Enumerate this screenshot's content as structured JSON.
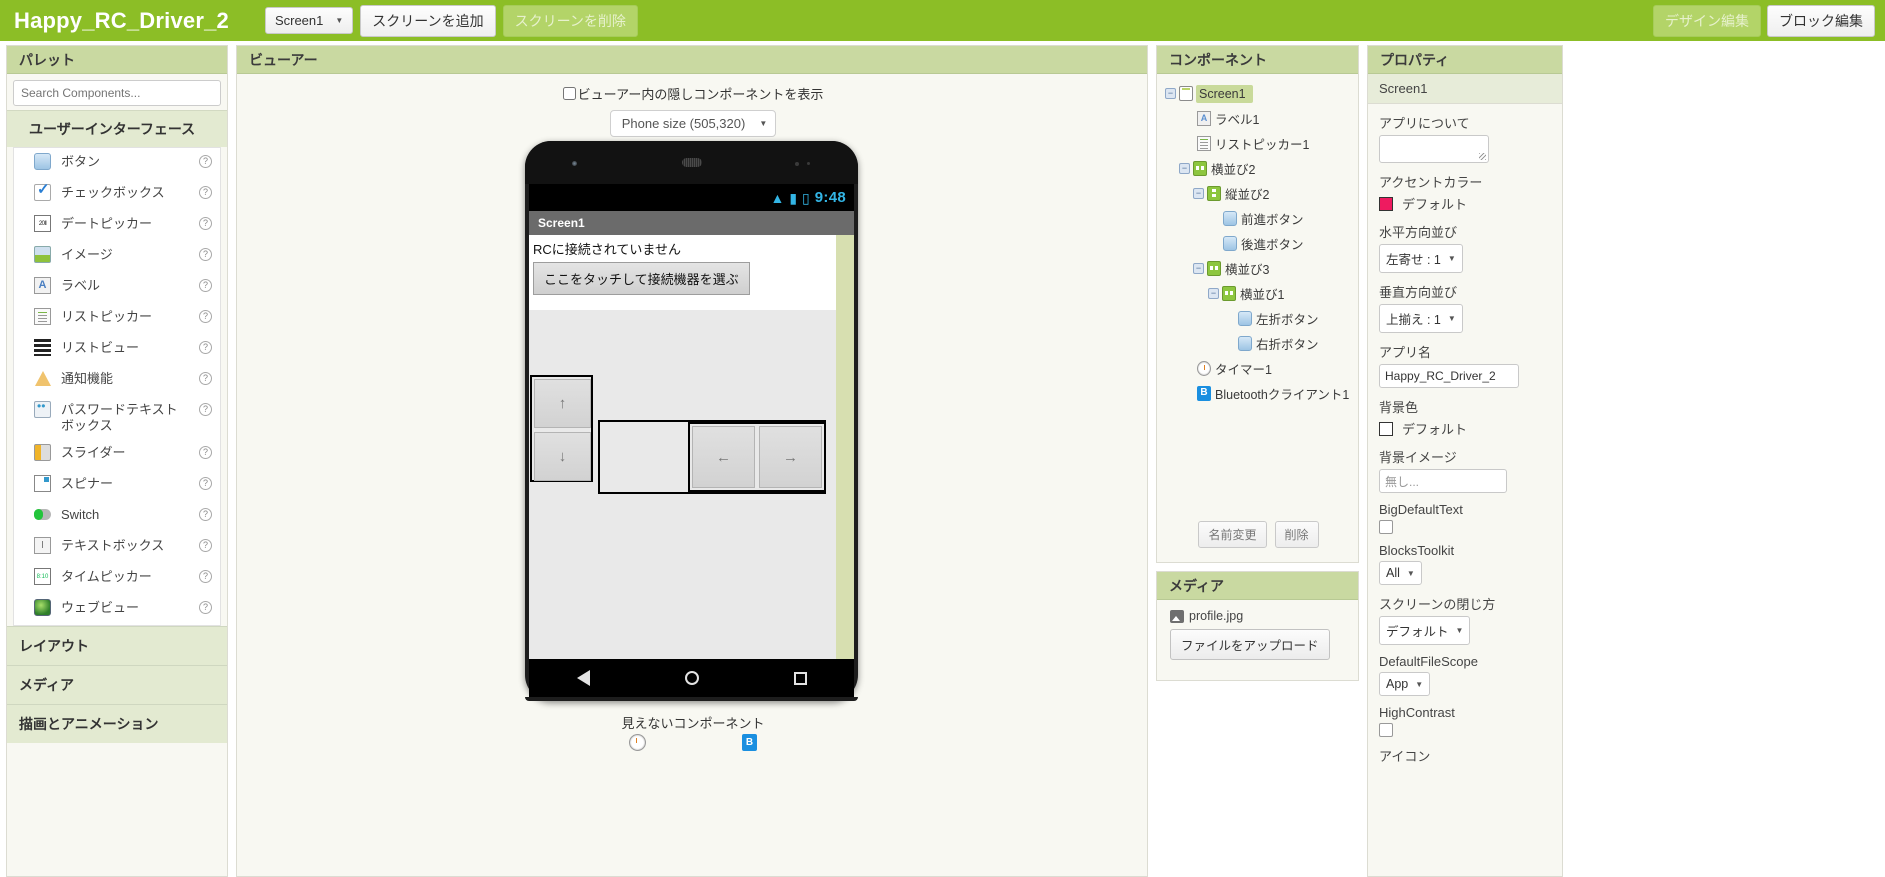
{
  "topbar": {
    "project_title": "Happy_RC_Driver_2",
    "screen_select": "Screen1",
    "add_screen": "スクリーンを追加",
    "remove_screen": "スクリーンを削除",
    "designer_tab": "デザイン編集",
    "blocks_tab": "ブロック編集",
    "brand_color": "#8cbe26"
  },
  "palette": {
    "title": "パレット",
    "search_placeholder": "Search Components...",
    "category": "ユーザーインターフェース",
    "items": [
      {
        "label": "ボタン",
        "icon": "button-icon",
        "help": "?"
      },
      {
        "label": "チェックボックス",
        "icon": "checkbox-icon",
        "help": "?"
      },
      {
        "label": "デートピッカー",
        "icon": "datepicker-icon",
        "help": "?"
      },
      {
        "label": "イメージ",
        "icon": "image-icon",
        "help": "?"
      },
      {
        "label": "ラベル",
        "icon": "label-icon",
        "help": "?"
      },
      {
        "label": "リストピッカー",
        "icon": "listpicker-icon",
        "help": "?"
      },
      {
        "label": "リストビュー",
        "icon": "listview-icon",
        "help": "?"
      },
      {
        "label": "通知機能",
        "icon": "notifier-icon",
        "help": "?"
      },
      {
        "label": "パスワードテキストボックス",
        "icon": "password-textbox-icon",
        "help": "?"
      },
      {
        "label": "スライダー",
        "icon": "slider-icon",
        "help": "?"
      },
      {
        "label": "スピナー",
        "icon": "spinner-icon",
        "help": "?"
      },
      {
        "label": "Switch",
        "icon": "switch-icon",
        "help": "?"
      },
      {
        "label": "テキストボックス",
        "icon": "textbox-icon",
        "help": "?"
      },
      {
        "label": "タイムピッカー",
        "icon": "timepicker-icon",
        "help": "?"
      },
      {
        "label": "ウェブビュー",
        "icon": "webview-icon",
        "help": "?"
      }
    ],
    "collapsed_categories": [
      "レイアウト",
      "メディア",
      "描画とアニメーション"
    ]
  },
  "viewer": {
    "title": "ビューアー",
    "show_hidden_label": "ビューアー内の隠しコンポーネントを表示",
    "show_hidden_checked": false,
    "phone_size": "Phone size (505,320)",
    "invisible_label": "見えないコンポーネント",
    "phone": {
      "status_time": "9:48",
      "title": "Screen1",
      "status_text": "RCに接続されていません",
      "listpicker_label": "ここをタッチして接続機器を選ぶ",
      "btn_forward": "↑",
      "btn_backward": "↓",
      "btn_left": "←",
      "btn_right": "→"
    }
  },
  "components": {
    "title": "コンポーネント",
    "tree": [
      {
        "label": "Screen1",
        "icon": "screen-icon",
        "depth": 0,
        "toggle": "−",
        "selected": true
      },
      {
        "label": "ラベル1",
        "icon": "label-icon",
        "depth": 1,
        "toggle": "",
        "selected": false
      },
      {
        "label": "リストピッカー1",
        "icon": "listpicker-icon",
        "depth": 1,
        "toggle": "",
        "selected": false
      },
      {
        "label": "横並び2",
        "icon": "horizontal-arrangement-icon",
        "depth": 1,
        "toggle": "−",
        "selected": false
      },
      {
        "label": "縦並び2",
        "icon": "vertical-arrangement-icon",
        "depth": 2,
        "toggle": "−",
        "selected": false
      },
      {
        "label": "前進ボタン",
        "icon": "button-icon",
        "depth": 3,
        "toggle": "",
        "selected": false
      },
      {
        "label": "後進ボタン",
        "icon": "button-icon",
        "depth": 3,
        "toggle": "",
        "selected": false
      },
      {
        "label": "横並び3",
        "icon": "horizontal-arrangement-icon",
        "depth": 2,
        "toggle": "−",
        "selected": false
      },
      {
        "label": "横並び1",
        "icon": "horizontal-arrangement-icon",
        "depth": 3,
        "toggle": "−",
        "selected": false
      },
      {
        "label": "左折ボタン",
        "icon": "button-icon",
        "depth": 4,
        "toggle": "",
        "selected": false
      },
      {
        "label": "右折ボタン",
        "icon": "button-icon",
        "depth": 4,
        "toggle": "",
        "selected": false
      },
      {
        "label": "タイマー1",
        "icon": "clock-icon",
        "depth": 1,
        "toggle": "",
        "selected": false
      },
      {
        "label": "Bluetoothクライアント1",
        "icon": "bluetooth-icon",
        "depth": 1,
        "toggle": "",
        "selected": false
      }
    ],
    "rename_button": "名前変更",
    "delete_button": "削除"
  },
  "media": {
    "title": "メディア",
    "files": [
      "profile.jpg"
    ],
    "upload_button": "ファイルをアップロード"
  },
  "properties": {
    "title": "プロパティ",
    "subject": "Screen1",
    "fields": [
      {
        "label": "アプリについて",
        "type": "textarea",
        "value": ""
      },
      {
        "label": "アクセントカラー",
        "type": "color",
        "value": "デフォルト",
        "color": "#ee1b60"
      },
      {
        "label": "水平方向並び",
        "type": "select",
        "value": "左寄せ : 1"
      },
      {
        "label": "垂直方向並び",
        "type": "select",
        "value": "上揃え : 1"
      },
      {
        "label": "アプリ名",
        "type": "input",
        "value": "Happy_RC_Driver_2"
      },
      {
        "label": "背景色",
        "type": "color",
        "value": "デフォルト",
        "color": "#ffffff"
      },
      {
        "label": "背景イメージ",
        "type": "input-placeholder",
        "value": "無し..."
      },
      {
        "label": "BigDefaultText",
        "type": "checkbox",
        "value": false
      },
      {
        "label": "BlocksToolkit",
        "type": "select",
        "value": "All"
      },
      {
        "label": "スクリーンの閉じ方",
        "type": "select",
        "value": "デフォルト"
      },
      {
        "label": "DefaultFileScope",
        "type": "select",
        "value": "App"
      },
      {
        "label": "HighContrast",
        "type": "checkbox",
        "value": false
      },
      {
        "label": "アイコン",
        "type": "label-only",
        "value": ""
      }
    ]
  }
}
